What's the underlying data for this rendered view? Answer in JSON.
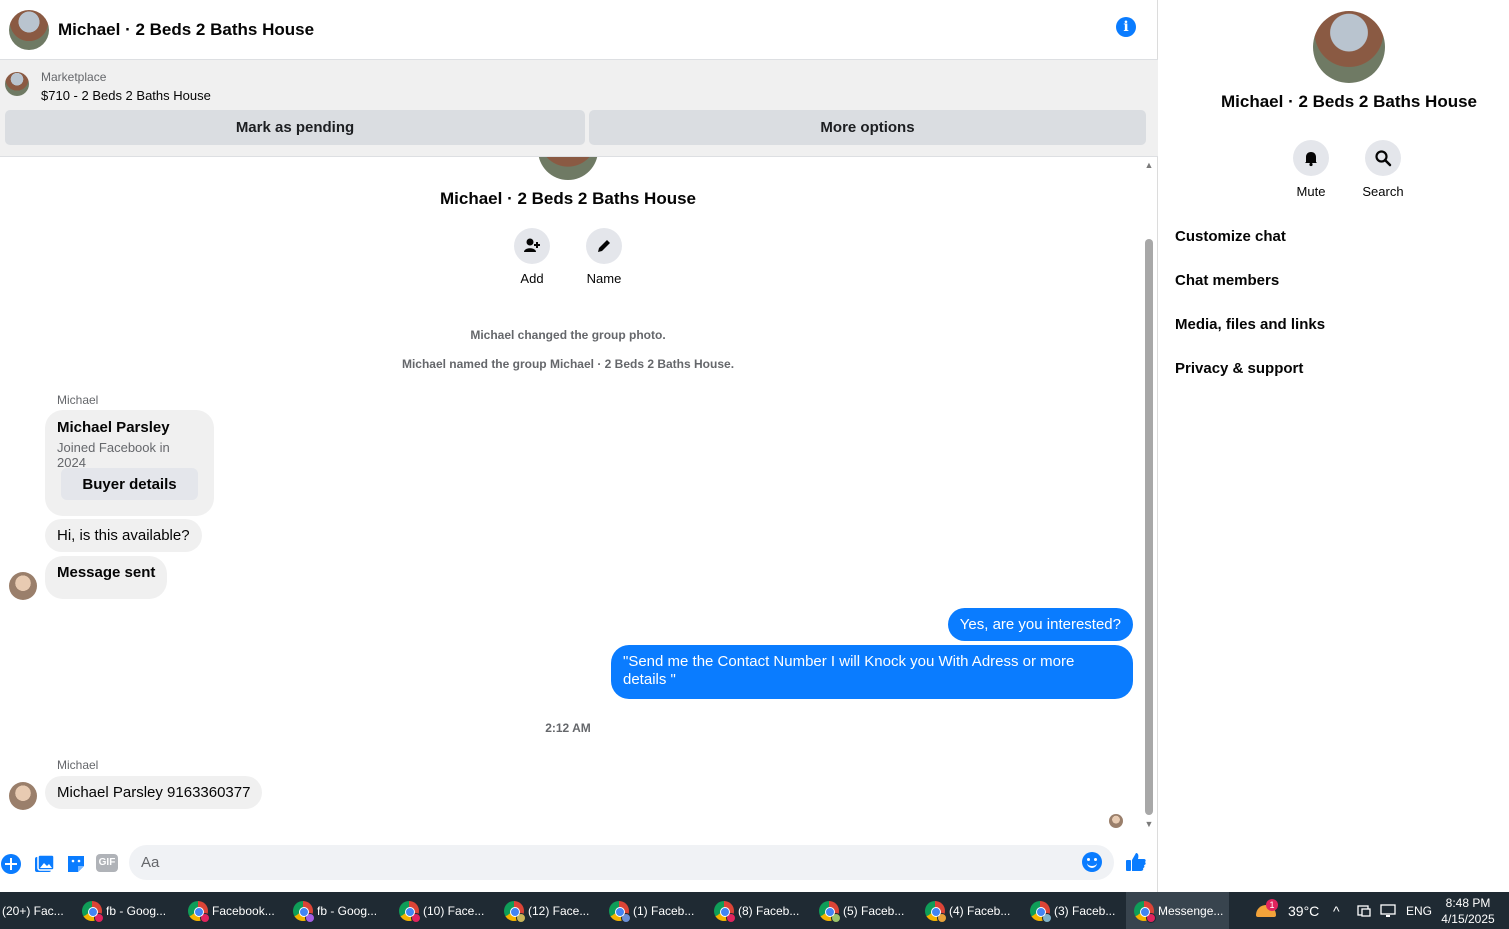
{
  "header": {
    "title": "Michael · 2 Beds 2 Baths House",
    "info_icon": "i"
  },
  "marketplace": {
    "label": "Marketplace",
    "item": "$710 - 2 Beds 2 Baths House",
    "pending_button": "Mark as pending",
    "more_button": "More options"
  },
  "thread": {
    "group_name": "Michael · 2 Beds 2 Baths House",
    "actions": [
      {
        "label": "Add",
        "icon": "add-person-icon"
      },
      {
        "label": "Name",
        "icon": "pencil-icon"
      }
    ],
    "system_messages": [
      "Michael changed the group photo.",
      "Michael named the group Michael · 2 Beds 2 Baths House."
    ],
    "sender_1": "Michael",
    "profile_card": {
      "name": "Michael Parsley",
      "joined": "Joined Facebook in 2024",
      "button": "Buyer details"
    },
    "incoming_1": "Hi, is this available?",
    "incoming_2": "Message sent",
    "outgoing_1": "Yes, are you interested?",
    "outgoing_2": "\"Send me the Contact Number I will Knock you With Adress or more details \"",
    "timestamp": "2:12 AM",
    "sender_2": "Michael",
    "incoming_3": "Michael Parsley 9163360377"
  },
  "composer": {
    "placeholder": "Aa",
    "gif_label": "GIF"
  },
  "panel": {
    "title": "Michael · 2 Beds 2 Baths House",
    "actions": [
      {
        "label": "Mute",
        "icon": "bell-icon"
      },
      {
        "label": "Search",
        "icon": "search-icon"
      }
    ],
    "items": [
      "Customize chat",
      "Chat members",
      "Media, files and links",
      "Privacy & support"
    ]
  },
  "taskbar": {
    "tasks": [
      "(20+) Fac...",
      "fb - Goog...",
      "Facebook...",
      "fb - Goog...",
      "(10) Face...",
      "(12) Face...",
      "(1) Faceb...",
      "(8) Faceb...",
      "(5) Faceb...",
      "(4) Faceb...",
      "(3) Faceb...",
      "Messenge..."
    ],
    "weather": "39°C",
    "weather_badge": "1",
    "language": "ENG",
    "time": "8:48 PM",
    "date": "4/15/2025"
  },
  "colors": {
    "accent": "#0a7cff",
    "bubble_in": "#f0f0f0",
    "taskbar": "#1f2a33"
  }
}
